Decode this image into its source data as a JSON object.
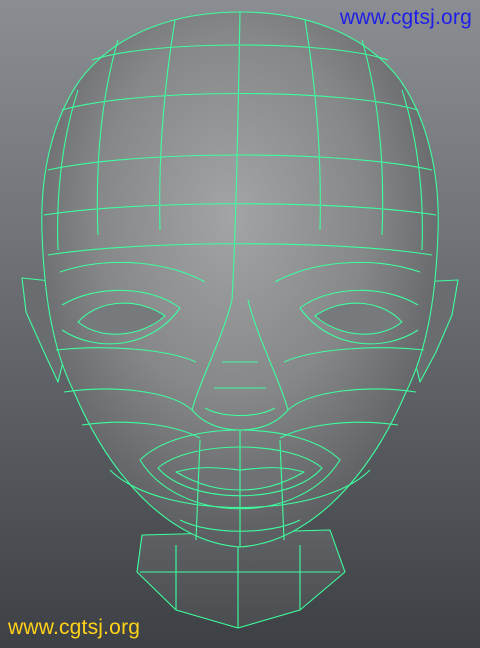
{
  "viewport": {
    "model_name": "head-wireframe",
    "wire_color": "#3dff9f",
    "surface_color": "#808080"
  },
  "watermarks": {
    "top_right": {
      "text": "www.cgtsj.org",
      "color": "#1f1fe8"
    },
    "bottom_left": {
      "text": "www.cgtsj.org",
      "color": "#ffd21a"
    }
  }
}
